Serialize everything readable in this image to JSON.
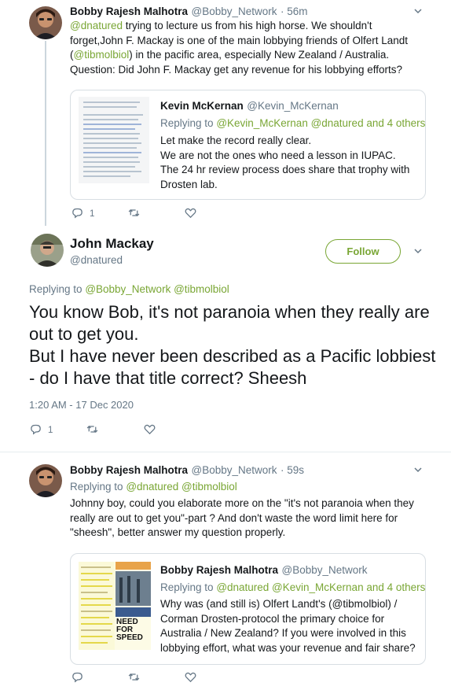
{
  "tweet1": {
    "name": "Bobby Rajesh Malhotra",
    "handle": "@Bobby_Network",
    "time": "· 56m",
    "mention": "@dnatured",
    "text_a": " trying to lecture us from his high horse. We shouldn't forget,John F. Mackay is one of the main lobbying friends of Olfert Landt (",
    "mention2": "@tibmolbiol",
    "text_b": ") in the pacific area, especially New Zealand / Australia. Question: Did John F. Mackay get any revenue for his lobbying efforts?",
    "reply_count": "1",
    "quote": {
      "name": "Kevin McKernan",
      "handle": "@Kevin_McKernan",
      "replying_label": "Replying to",
      "replying_to": "@Kevin_McKernan @dnatured and 4 others",
      "lines": [
        "Let make the record really clear.",
        "We are not the ones who need a lesson in IUPAC.",
        "The 24 hr review process does share that trophy with Drosten lab."
      ]
    }
  },
  "main_tweet": {
    "name": "John Mackay",
    "handle": "@dnatured",
    "follow_label": "Follow",
    "replying_label": "Replying to",
    "replying_to": "@Bobby_Network @tibmolbiol",
    "line1": "You know Bob, it's not paranoia when they really are out to get you.",
    "line2": "But I have never been described as a Pacific lobbiest - do I have that title correct? Sheesh",
    "timestamp": "1:20 AM - 17 Dec 2020",
    "reply_count": "1"
  },
  "tweet3": {
    "name": "Bobby Rajesh Malhotra",
    "handle": "@Bobby_Network",
    "time": "· 59s",
    "replying_label": "Replying to",
    "replying_to": "@dnatured @tibmolbiol",
    "text": "Johnny boy, could you elaborate more on the \"it's not paranoia when they really are out to get you\"-part ? And don't waste the word limit here for \"sheesh\", better answer my question properly.",
    "quote": {
      "name": "Bobby Rajesh Malhotra",
      "handle": "@Bobby_Network",
      "replying_label": "Replying to",
      "replying_to": "@dnatured @Kevin_McKernan and 4 others",
      "text": "Why was (and still is) Olfert Landt's (@tibmolbiol) / Corman Drosten-protocol the primary choice for Australia / New Zealand? If you were involved in this lobbying effort, what was your revenue and fair share?",
      "thumb_headline": "NEED FOR SPEED"
    }
  },
  "colors": {
    "link": "#79a634",
    "muted": "#657786"
  },
  "icons": [
    "reply-icon",
    "retweet-icon",
    "like-icon",
    "chevron-down-icon"
  ]
}
